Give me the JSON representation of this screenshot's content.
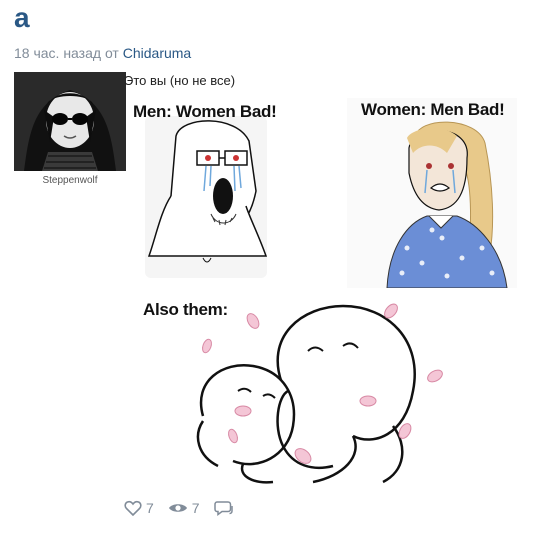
{
  "post": {
    "title": "a",
    "time_ago": "18 час. назад от",
    "author": "Chidaruma",
    "caption": "Это вы (но не все)"
  },
  "user": {
    "name": "Steppenwolf"
  },
  "meme": {
    "panel1_label": "Men: Women Bad!",
    "panel2_label": "Women: Men Bad!",
    "panel3_label": "Also them:"
  },
  "stats": {
    "likes": "7",
    "views": "7"
  },
  "icons": [
    "heart-icon",
    "eye-icon",
    "comment-icon"
  ]
}
